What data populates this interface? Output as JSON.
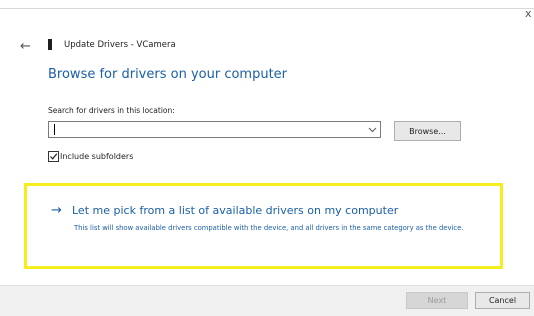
{
  "window": {
    "close_glyph": "x",
    "back_glyph": "←",
    "title": "Update Drivers - VCamera"
  },
  "main": {
    "heading": "Browse for drivers on your computer",
    "search_label": "Search for drivers in this location:",
    "path_value": "",
    "browse_label": "Browse...",
    "include_subfolders_label": "Include subfolders",
    "include_subfolders_checked": true
  },
  "pick_option": {
    "arrow_glyph": "→",
    "title": "Let me pick from a list of available drivers on my computer",
    "description": "This list will show available drivers compatible with the device, and all drivers in the same category as the device."
  },
  "footer": {
    "next_label": "Next",
    "cancel_label": "Cancel"
  },
  "colors": {
    "link_blue": "#1a5fa8",
    "highlight_yellow": "#f4ee1c"
  },
  "icons": {
    "device": "device-icon",
    "back": "back-arrow-icon",
    "close": "close-icon",
    "chevron": "chevron-down-icon",
    "check": "checkmark-icon",
    "pick": "arrow-right-icon"
  }
}
